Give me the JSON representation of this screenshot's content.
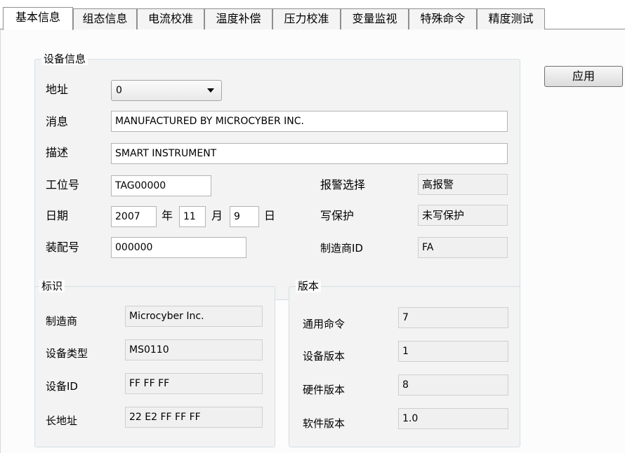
{
  "tabs": [
    "基本信息",
    "组态信息",
    "电流校准",
    "温度补偿",
    "压力校准",
    "变量监视",
    "特殊命令",
    "精度测试"
  ],
  "device_info": {
    "title": "设备信息",
    "address_label": "地址",
    "address_value": "0",
    "message_label": "消息",
    "message_value": "MANUFACTURED BY MICROCYBER INC.",
    "descriptor_label": "描述",
    "descriptor_value": "SMART INSTRUMENT",
    "tag_label": "工位号",
    "tag_value": "TAG00000",
    "date_label": "日期",
    "year_value": "2007",
    "year_unit": "年",
    "month_value": "11",
    "month_unit": "月",
    "day_value": "9",
    "day_unit": "日",
    "assembly_label": "装配号",
    "assembly_value": "000000",
    "alarm_label": "报警选择",
    "alarm_value": "高报警",
    "write_protect_label": "写保护",
    "write_protect_value": "未写保护",
    "manufacturer_id_label": "制造商ID",
    "manufacturer_id_value": "FA"
  },
  "identity": {
    "title": "标识",
    "manufacturer_label": "制造商",
    "manufacturer_value": "Microcyber Inc.",
    "device_type_label": "设备类型",
    "device_type_value": "MS0110",
    "device_id_label": "设备ID",
    "device_id_value": "FF FF FF",
    "long_address_label": "长地址",
    "long_address_value": "22 E2 FF FF FF"
  },
  "version": {
    "title": "版本",
    "universal_cmd_label": "通用命令",
    "universal_cmd_value": "7",
    "device_rev_label": "设备版本",
    "device_rev_value": "1",
    "hardware_rev_label": "硬件版本",
    "hardware_rev_value": "8",
    "software_rev_label": "软件版本",
    "software_rev_value": "1.0"
  },
  "apply_label": "应用"
}
